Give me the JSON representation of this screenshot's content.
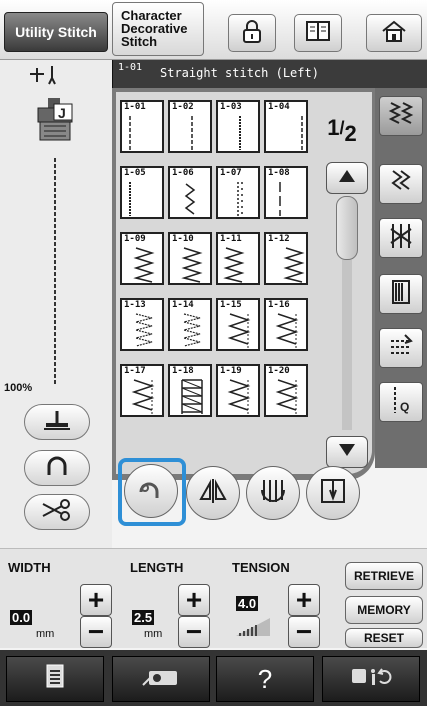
{
  "tabs": {
    "utility": "Utility Stitch",
    "character": "Character\nDecorative\nStitch"
  },
  "header": {
    "selected_code": "1-01",
    "selected_name": "Straight stitch (Left)"
  },
  "stitches": [
    {
      "code": "1-01",
      "icon": "straight-left"
    },
    {
      "code": "1-02",
      "icon": "straight-middle"
    },
    {
      "code": "1-03",
      "icon": "triple-middle"
    },
    {
      "code": "1-04",
      "icon": "straight-right"
    },
    {
      "code": "1-05",
      "icon": "triple-left"
    },
    {
      "code": "1-06",
      "icon": "stem"
    },
    {
      "code": "1-07",
      "icon": "decorative-straight"
    },
    {
      "code": "1-08",
      "icon": "basting"
    },
    {
      "code": "1-09",
      "icon": "zigzag"
    },
    {
      "code": "1-10",
      "icon": "zigzag"
    },
    {
      "code": "1-11",
      "icon": "zigzag-left"
    },
    {
      "code": "1-12",
      "icon": "zigzag-right"
    },
    {
      "code": "1-13",
      "icon": "3step-zigzag"
    },
    {
      "code": "1-14",
      "icon": "3step-zigzag"
    },
    {
      "code": "1-15",
      "icon": "overcasting"
    },
    {
      "code": "1-16",
      "icon": "overcasting"
    },
    {
      "code": "1-17",
      "icon": "overcasting"
    },
    {
      "code": "1-18",
      "icon": "overcasting-ladder"
    },
    {
      "code": "1-19",
      "icon": "overcasting"
    },
    {
      "code": "1-20",
      "icon": "overcasting"
    }
  ],
  "page": {
    "current": "1",
    "total": "2"
  },
  "left_panel": {
    "zoom": "100%"
  },
  "controls": {
    "width": {
      "label": "WIDTH",
      "value": "0.0",
      "unit": "mm"
    },
    "length": {
      "label": "LENGTH",
      "value": "2.5",
      "unit": "mm"
    },
    "tension": {
      "label": "TENSION",
      "value": "4.0"
    }
  },
  "right_buttons": {
    "retrieve": "RETRIEVE",
    "memory": "MEMORY",
    "reset": "RESET"
  },
  "bottom": {
    "help": "?"
  },
  "colors": {
    "accent": "#2e8fd6",
    "dark_header": "#3b3b3b",
    "frame": "#7a7a7a"
  }
}
